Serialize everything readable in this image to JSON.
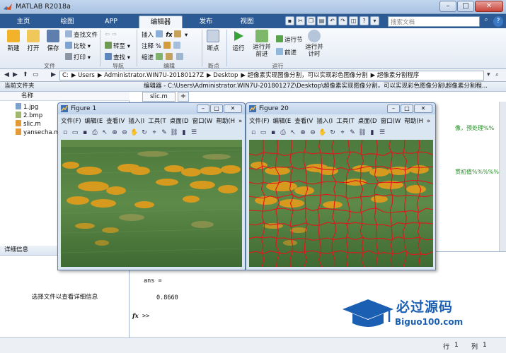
{
  "app": {
    "title": "MATLAB R2018a"
  },
  "tabs": [
    {
      "label": "主页"
    },
    {
      "label": "绘图"
    },
    {
      "label": "APP"
    },
    {
      "label": "编辑器"
    },
    {
      "label": "发布"
    },
    {
      "label": "视图"
    }
  ],
  "search": {
    "placeholder": "搜索文档"
  },
  "ribbon": {
    "file": {
      "new": "新建",
      "open": "打开",
      "save": "保存",
      "find_file": "查找文件",
      "compare": "比较",
      "print": "打印",
      "group": "文件"
    },
    "nav": {
      "goto": "转至",
      "find": "查找",
      "group": "导航"
    },
    "edit": {
      "insert": "插入",
      "comment": "注释",
      "indent": "缩进",
      "group": "编辑"
    },
    "breakpoint": {
      "label": "断点",
      "group": "断点"
    },
    "run": {
      "run": "运行",
      "run_advance": "运行并\n前进",
      "run_section": "运行节",
      "advance": "前进",
      "run_time": "运行并\n计时",
      "group": "运行"
    }
  },
  "address": {
    "parts": [
      "C:",
      "Users",
      "Administrator.WIN7U-20180127Z",
      "Desktop",
      "超像素实现图像分割，可以实现彩色图像分割",
      "超像素分割程序"
    ]
  },
  "left_panel": {
    "header": "当前文件夹",
    "column": "名称",
    "files": [
      "1.jpg",
      "2.bmp",
      "slic.m",
      "yansecha.m"
    ],
    "detail_header": "详细信息",
    "detail_text": "选择文件以查看详细信息"
  },
  "editor": {
    "header": "编辑器 - C:\\Users\\Administrator.WIN7U-20180127Z\\Desktop\\超像素实现图像分割，可以实现彩色图像分割\\超像素分割程...",
    "tab": "slic.m",
    "code1": "像，预处理%%",
    "code2": "贯初值%%%%%"
  },
  "command": {
    "ans": "ans =",
    "value": "0.8660",
    "prompt": ">>"
  },
  "status": {
    "row_label": "行",
    "row": "1",
    "col_label": "列",
    "col": "1"
  },
  "figures": [
    {
      "title": "Figure 1"
    },
    {
      "title": "Figure 20"
    }
  ],
  "figure_menu": [
    "文件(F)",
    "编辑(E",
    "查看(V",
    "插入(I",
    "工具(T",
    "桌面(D",
    "窗口(W",
    "帮助(H"
  ],
  "watermark": {
    "title": "必过源码",
    "subtitle": "Biguo100.com"
  },
  "colors": {
    "tab_strip": "#2c5a94",
    "leaf_green": "#4f7a3c",
    "rust_orange": "#d59a1e",
    "superpixel_red": "#e0161b"
  }
}
